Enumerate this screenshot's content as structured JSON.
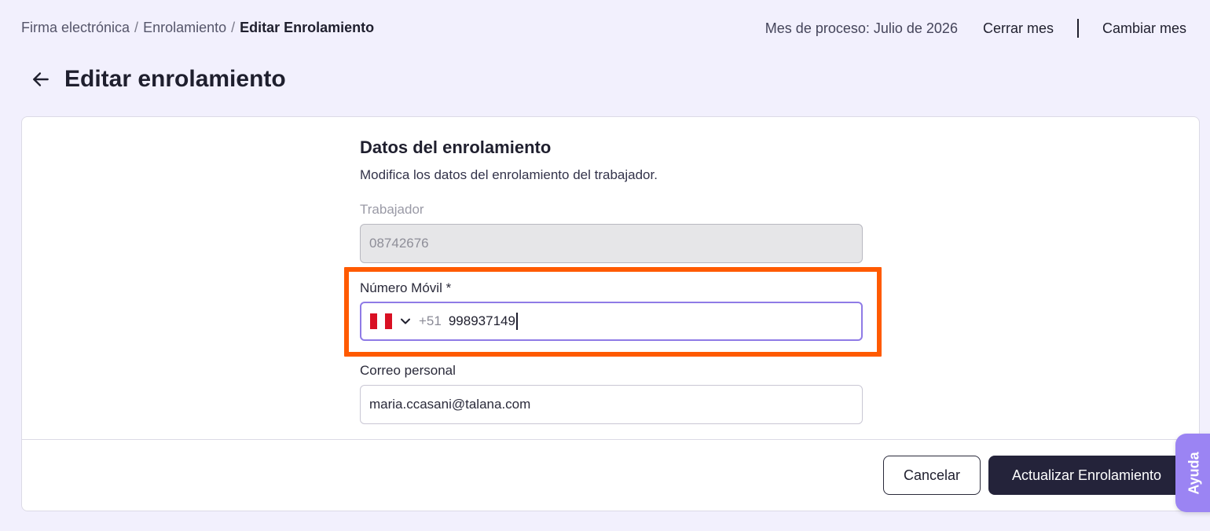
{
  "breadcrumb": {
    "items": [
      "Firma electrónica",
      "Enrolamiento"
    ],
    "separator": "/",
    "current": "Editar Enrolamiento"
  },
  "header": {
    "process_month": "Mes de proceso: Julio de 2026",
    "close_month": "Cerrar mes",
    "change_month": "Cambiar mes"
  },
  "page": {
    "title": "Editar enrolamiento",
    "back_icon": "arrow-left-icon"
  },
  "form": {
    "title": "Datos del enrolamiento",
    "subtitle": "Modifica los datos del enrolamiento del trabajador.",
    "worker": {
      "label": "Trabajador",
      "value": "08742676"
    },
    "mobile": {
      "label": "Número Móvil *",
      "country_flag": "peru-flag-icon",
      "dial_code": "+51",
      "value": "998937149"
    },
    "email": {
      "label": "Correo personal",
      "value": "maria.ccasani@talana.com"
    }
  },
  "actions": {
    "cancel": "Cancelar",
    "submit": "Actualizar Enrolamiento"
  },
  "help": {
    "label": "Ayuda"
  },
  "colors": {
    "background": "#f2f0fd",
    "primary_button": "#24233a",
    "focus_border": "#8f7be6",
    "highlight": "#ff5a00",
    "help_tab": "#9b84f3"
  }
}
